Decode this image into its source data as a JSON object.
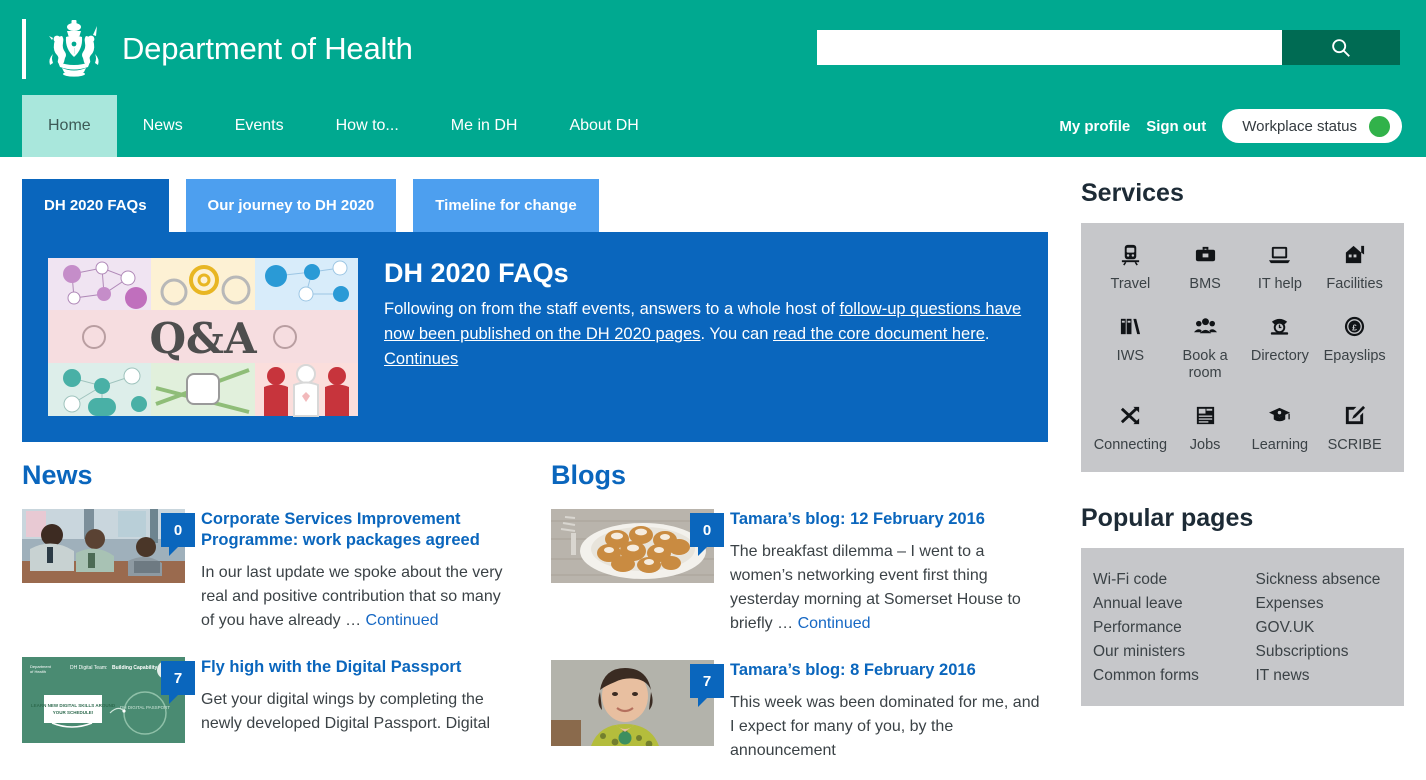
{
  "header": {
    "brand_title": "Department of Health",
    "crest_icon": "royal-coat-of-arms-icon",
    "search": {
      "value": "",
      "placeholder": "",
      "icon": "search-icon"
    }
  },
  "nav": {
    "items": [
      {
        "label": "Home",
        "active": true
      },
      {
        "label": "News",
        "active": false
      },
      {
        "label": "Events",
        "active": false
      },
      {
        "label": "How to...",
        "active": false
      },
      {
        "label": "Me in DH",
        "active": false
      },
      {
        "label": "About DH",
        "active": false
      }
    ],
    "my_profile": "My profile",
    "sign_out": "Sign out",
    "workplace_status": "Workplace status",
    "status_color": "#31b24a"
  },
  "carousel": {
    "tabs": [
      {
        "label": "DH 2020 FAQs",
        "active": true
      },
      {
        "label": "Our journey to DH 2020",
        "active": false
      },
      {
        "label": "Timeline for change",
        "active": false
      }
    ],
    "feature": {
      "title": "DH 2020 FAQs",
      "thumb_icon": "q-and-a-collage-image",
      "text_parts": [
        {
          "text": "Following on from the staff events, answers to a whole host of ",
          "link": false
        },
        {
          "text": "follow-up questions have now been published on the DH 2020 pages",
          "link": true
        },
        {
          "text": ". You can ",
          "link": false
        },
        {
          "text": "read the core document here",
          "link": true
        },
        {
          "text": ". ",
          "link": false
        },
        {
          "text": "Continues",
          "link": true
        }
      ]
    }
  },
  "news": {
    "heading": "News",
    "items": [
      {
        "badge": "0",
        "title": "Corporate Services Improvement Programme: work packages agreed",
        "excerpt": "In our last update we spoke about the very real and positive contribution that so many of you have already … ",
        "more": "Continued",
        "thumb_icon": "meeting-photo"
      },
      {
        "badge": "7",
        "title": "Fly high with the Digital Passport",
        "excerpt": "Get your digital wings by completing the newly developed Digital Passport. Digital",
        "more": "",
        "thumb_icon": "digital-passport-slide-image"
      }
    ]
  },
  "blogs": {
    "heading": "Blogs",
    "items": [
      {
        "badge": "0",
        "title": "Tamara’s blog: 12 February 2016",
        "excerpt": "The breakfast dilemma – I went to a women’s networking event first thing yesterday morning at Somerset House to briefly … ",
        "more": "Continued",
        "thumb_icon": "pastries-photo"
      },
      {
        "badge": "7",
        "title": "Tamara’s blog: 8 February 2016",
        "excerpt": "This week was been dominated for me, and I expect for many of you, by the announcement",
        "more": "",
        "thumb_icon": "portrait-photo"
      }
    ]
  },
  "services": {
    "heading": "Services",
    "items": [
      {
        "label": "Travel",
        "icon": "train-icon",
        "glyph": "🚆"
      },
      {
        "label": "BMS",
        "icon": "briefcase-icon",
        "glyph": "💼"
      },
      {
        "label": "IT help",
        "icon": "laptop-icon",
        "glyph": "💻"
      },
      {
        "label": "Facilities",
        "icon": "house-icon",
        "glyph": "🏠"
      },
      {
        "label": "IWS",
        "icon": "books-icon",
        "glyph": "📚"
      },
      {
        "label": "Book a room",
        "icon": "people-group-icon",
        "glyph": "👥"
      },
      {
        "label": "Directory",
        "icon": "telephone-icon",
        "glyph": "☎"
      },
      {
        "label": "Epayslips",
        "icon": "pound-coin-icon",
        "glyph": "£"
      },
      {
        "label": "Connecting",
        "icon": "shuffle-arrows-icon",
        "glyph": "⇄"
      },
      {
        "label": "Jobs",
        "icon": "newspaper-icon",
        "glyph": "📰"
      },
      {
        "label": "Learning",
        "icon": "graduation-cap-icon",
        "glyph": "🎓"
      },
      {
        "label": "SCRIBE",
        "icon": "pencil-edit-icon",
        "glyph": "✎"
      }
    ]
  },
  "popular": {
    "heading": "Popular pages",
    "col1": [
      "Wi-Fi code",
      "Annual leave",
      "Performance",
      "Our ministers",
      "Common forms"
    ],
    "col2": [
      "Sickness absence",
      "Expenses",
      "GOV.UK",
      "Subscriptions",
      "IT news"
    ]
  },
  "colors": {
    "teal": "#00a990",
    "teal_dark": "#006b53",
    "mint": "#a9e7dc",
    "blue": "#0a66bd",
    "blue_light": "#4d9fef",
    "panel_gray": "#c6c7ca"
  }
}
